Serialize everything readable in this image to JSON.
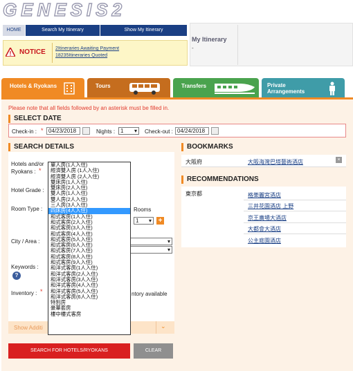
{
  "logo": {
    "text": "GENESIS2"
  },
  "nav": {
    "home": "HOME",
    "search_itinerary": "Search My Itinerary",
    "show_itinerary": "Show My Itinerary"
  },
  "notice": {
    "label": "NOTICE",
    "line1": "2Itineraries Awaiting Payment",
    "line2": "18235Itineraries Quoted"
  },
  "itinerary": {
    "title": "My Itinerary",
    "value": "-"
  },
  "tabs": [
    {
      "label": "Hotels & Ryokans"
    },
    {
      "label": "Tours"
    },
    {
      "label": "Transfers"
    },
    {
      "label": "Private Arrangements"
    }
  ],
  "warning": "Please note that all fields followed by an asterisk must be filled in.",
  "select_date": {
    "title": "SELECT DATE",
    "checkin_label": "Check-in :",
    "checkin_value": "04/23/2018",
    "nights_label": "Nights :",
    "nights_value": "1",
    "checkout_label": "Check-out :",
    "checkout_value": "04/24/2018",
    "asterisk": "*"
  },
  "search_details": {
    "title": "SEARCH DETAILS",
    "hotels_label_1": "Hotels and/or",
    "hotels_label_2": "Ryokans :",
    "hotel_grade": "Hotel Grade :",
    "room_type": "Room Type :",
    "rooms": "Rooms",
    "rooms_value": "1",
    "city_area": "City / Area :",
    "keywords": "Keywords :",
    "inventory": "Inventory :",
    "inventory_text": "ntory available",
    "show_additional": "Show Additi",
    "search_button": "SEARCH FOR HOTELS/RYOKANS",
    "clear_button": "CLEAR"
  },
  "room_options": [
    "單人房(1人入住)",
    "經濟雙人房 (1人入住)",
    "經濟雙人房 (2人入住)",
    "雙床房(1人入住)",
    "雙床房(2人入住)",
    "雙人房(1人入住)",
    "雙人房(2人入住)",
    "三人房(3人入住)",
    "四床房(4人入住)",
    "和式客房(1人入住)",
    "和式客房(2人入住)",
    "和式客房(3人入住)",
    "和式客房(4人入住)",
    "和式客房(5人入住)",
    "和式客房(6人入住)",
    "和式客房(7人入住)",
    "和式客房(8人入住)",
    "和式客房(9人入住)",
    "和洋式客房(1人入住)",
    "和洋式客房(2人入住)",
    "和洋式客房(3人入住)",
    "和洋式客房(4人入住)",
    "和洋式客房(5人入住)",
    "和洋式客房(6人入住)",
    "特別房",
    "豪華套房",
    "樓中樓式客房"
  ],
  "room_selected_index": 8,
  "bookmarks": {
    "title": "BOOKMARKS",
    "region": "大阪府",
    "hotel": "大阪海灣巴塔藝術酒店"
  },
  "recommendations": {
    "title": "RECOMMENDATIONS",
    "region": "東京都",
    "hotels": [
      "格樂麗宮酒店",
      "三井花園酒店 上野",
      "京王廣場大酒店",
      "大都會大酒店",
      "公主庭園酒店"
    ]
  },
  "colors": {
    "orange": "#f08a24",
    "navy": "#1a3f84",
    "red": "#d92020"
  }
}
